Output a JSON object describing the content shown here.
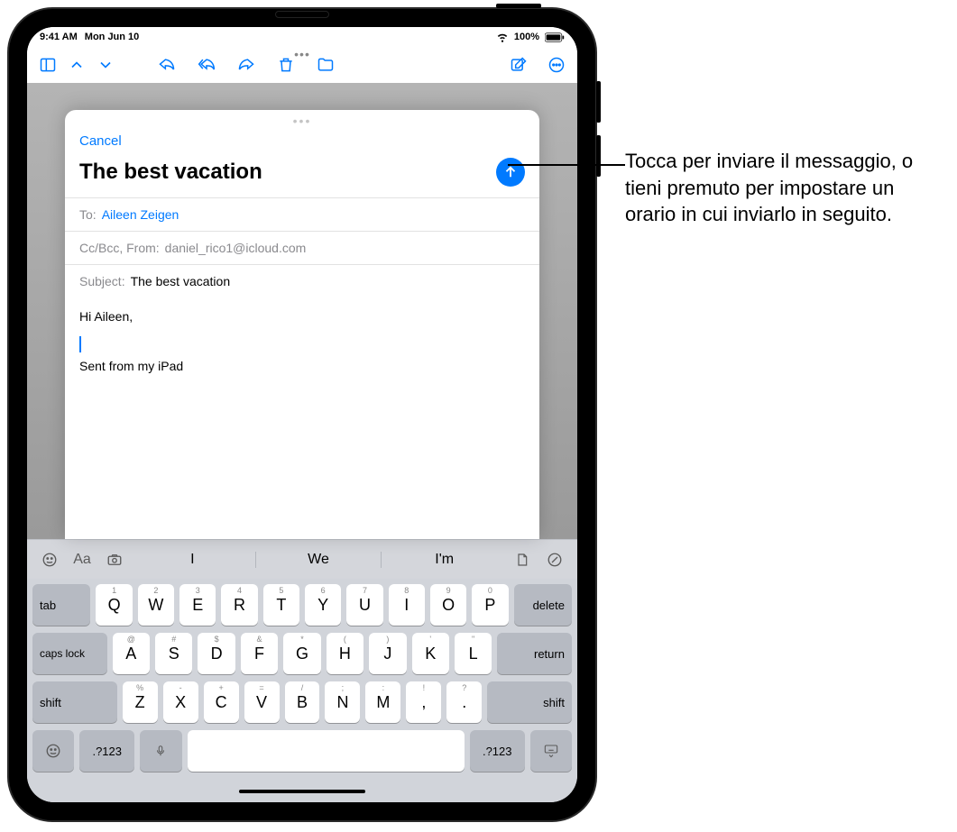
{
  "status": {
    "time": "9:41 AM",
    "date": "Mon Jun 10",
    "battery_pct": "100%"
  },
  "compose": {
    "cancel": "Cancel",
    "title": "The best vacation",
    "to_label": "To:",
    "to_value": "Aileen Zeigen",
    "ccbcc_label": "Cc/Bcc, From:",
    "from_value": "daniel_rico1@icloud.com",
    "subject_label": "Subject:",
    "subject_value": "The best vacation",
    "body_greeting": "Hi Aileen,",
    "body_signature": "Sent from my iPad"
  },
  "predictions": [
    "I",
    "We",
    "I'm"
  ],
  "keyboard": {
    "row1": [
      {
        "main": "Q",
        "sub": "1"
      },
      {
        "main": "W",
        "sub": "2"
      },
      {
        "main": "E",
        "sub": "3"
      },
      {
        "main": "R",
        "sub": "4"
      },
      {
        "main": "T",
        "sub": "5"
      },
      {
        "main": "Y",
        "sub": "6"
      },
      {
        "main": "U",
        "sub": "7"
      },
      {
        "main": "I",
        "sub": "8"
      },
      {
        "main": "O",
        "sub": "9"
      },
      {
        "main": "P",
        "sub": "0"
      }
    ],
    "tab": "tab",
    "delete": "delete",
    "row2": [
      {
        "main": "A",
        "sub": "@"
      },
      {
        "main": "S",
        "sub": "#"
      },
      {
        "main": "D",
        "sub": "$"
      },
      {
        "main": "F",
        "sub": "&"
      },
      {
        "main": "G",
        "sub": "*"
      },
      {
        "main": "H",
        "sub": "("
      },
      {
        "main": "J",
        "sub": ")"
      },
      {
        "main": "K",
        "sub": "'"
      },
      {
        "main": "L",
        "sub": "\""
      }
    ],
    "caps": "caps lock",
    "return": "return",
    "row3": [
      {
        "main": "Z",
        "sub": "%"
      },
      {
        "main": "X",
        "sub": "-"
      },
      {
        "main": "C",
        "sub": "+"
      },
      {
        "main": "V",
        "sub": "="
      },
      {
        "main": "B",
        "sub": "/"
      },
      {
        "main": "N",
        "sub": ";"
      },
      {
        "main": "M",
        "sub": ":"
      },
      {
        "main": ",",
        "sub": "!"
      },
      {
        "main": ".",
        "sub": "?"
      }
    ],
    "shift": "shift",
    "numkey": ".?123"
  },
  "callout": "Tocca per inviare il messaggio, o tieni premuto per impostare un orario in cui inviarlo in seguito."
}
